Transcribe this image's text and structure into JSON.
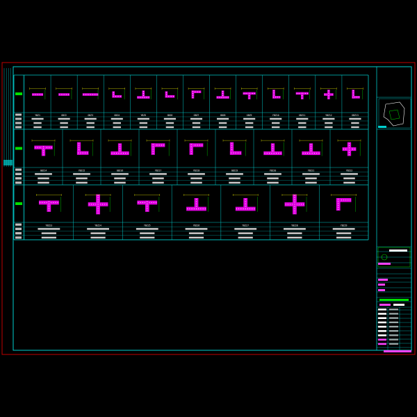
{
  "drawing": {
    "background": "#000000",
    "colors": {
      "outer_border": "#c00000",
      "inner_border": "#00d0d0",
      "grid_lines": "#00c8c8",
      "wall_fill": "#e000e0",
      "rebar_dots": "#ffffff",
      "dimensions": "#e0e000",
      "text_green": "#00e000",
      "text_magenta": "#ff40ff",
      "text_white": "#ffffff"
    },
    "legend_glyph": "wall-section-icon",
    "title_block": {
      "logo": "site-plan-icon"
    }
  },
  "rows": [
    {
      "key": "row1",
      "type_marks": [
        "YBZ1",
        "GBZ2",
        "GBZ3",
        "GBZ4",
        "YBZ5",
        "GBZ6",
        "GBZ7",
        "GBZ8",
        "GBZ9",
        "YBZ10",
        "GBZ11",
        "YBZ12",
        "GBZ13"
      ],
      "shapes": [
        "bar",
        "bar",
        "bar-long",
        "L-right",
        "T-up",
        "L-right",
        "L-down",
        "T-up",
        "T-down",
        "L-up",
        "T-down",
        "T-cross",
        "L-up"
      ]
    },
    {
      "key": "row2",
      "type_marks": [
        "GBZ14",
        "YBZ15",
        "GBZ16",
        "YBZ17",
        "YBZ18",
        "GBZ19",
        "YBZ20",
        "YBZ21",
        "YBZ22"
      ],
      "shapes": [
        "T-down",
        "L-up",
        "T-up",
        "L-down",
        "L-down",
        "L-up",
        "T-up",
        "T-up",
        "T-cross"
      ]
    },
    {
      "key": "row3",
      "type_marks": [
        "YBZ23",
        "YBZ24",
        "YBZ25",
        "YBZ26",
        "YBZ27",
        "YBZ28",
        "YBZ29"
      ],
      "shapes": [
        "T-down",
        "cross",
        "T-down",
        "T-up",
        "T-up",
        "cross",
        "L-down"
      ]
    }
  ]
}
